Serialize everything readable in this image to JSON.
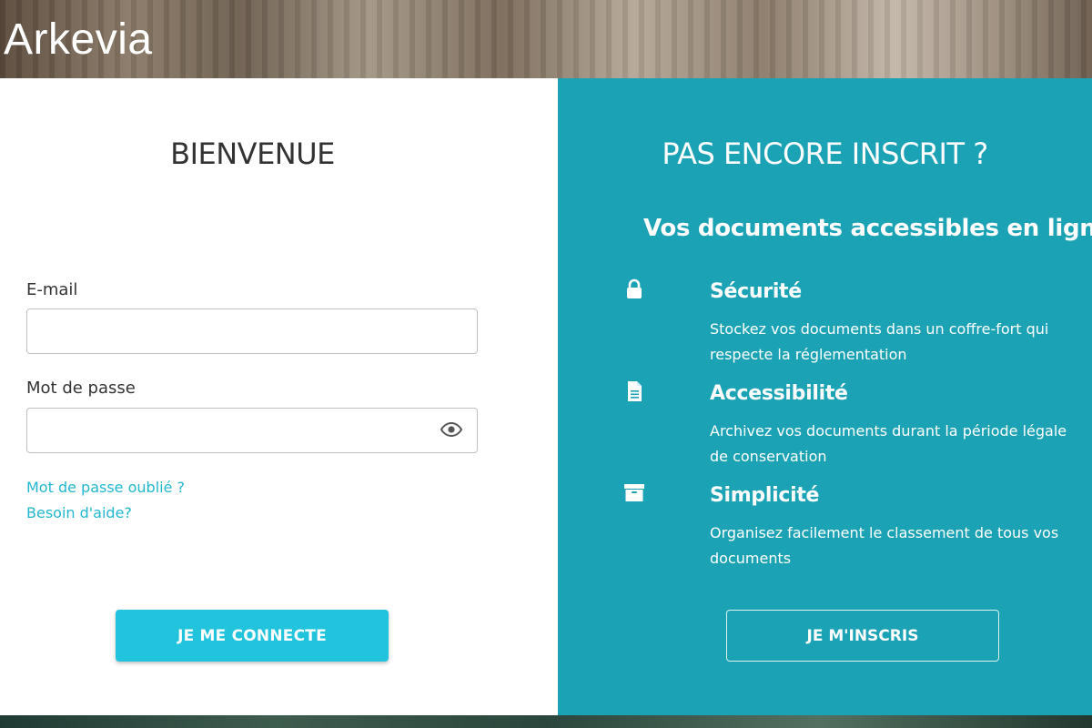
{
  "header": {
    "logo_text": "Arkevia"
  },
  "login": {
    "title": "BIENVENUE",
    "email_label": "E-mail",
    "email_value": "",
    "password_label": "Mot de passe",
    "password_value": "",
    "show_password_icon": "eye-icon",
    "forgot_password_link": "Mot de passe oublié ?",
    "help_link": "Besoin d'aide?",
    "connect_button": "JE ME CONNECTE"
  },
  "register": {
    "title": "PAS ENCORE INSCRIT ?",
    "subtitle": "Vos documents accessibles en ligne",
    "features": [
      {
        "icon": "lock-icon",
        "title": "Sécurité",
        "description": "Stockez vos documents dans un coffre-fort qui respecte la réglementation"
      },
      {
        "icon": "document-icon",
        "title": "Accessibilité",
        "description": "Archivez vos documents durant la période légale de conservation"
      },
      {
        "icon": "archive-box-icon",
        "title": "Simplicité",
        "description": "Organisez facilement le classement de tous vos documents"
      }
    ],
    "register_button": "JE M'INSCRIS"
  },
  "colors": {
    "accent_teal": "#1ca2b5",
    "button_cyan": "#22c4dd",
    "link_cyan": "#23b7cf"
  }
}
